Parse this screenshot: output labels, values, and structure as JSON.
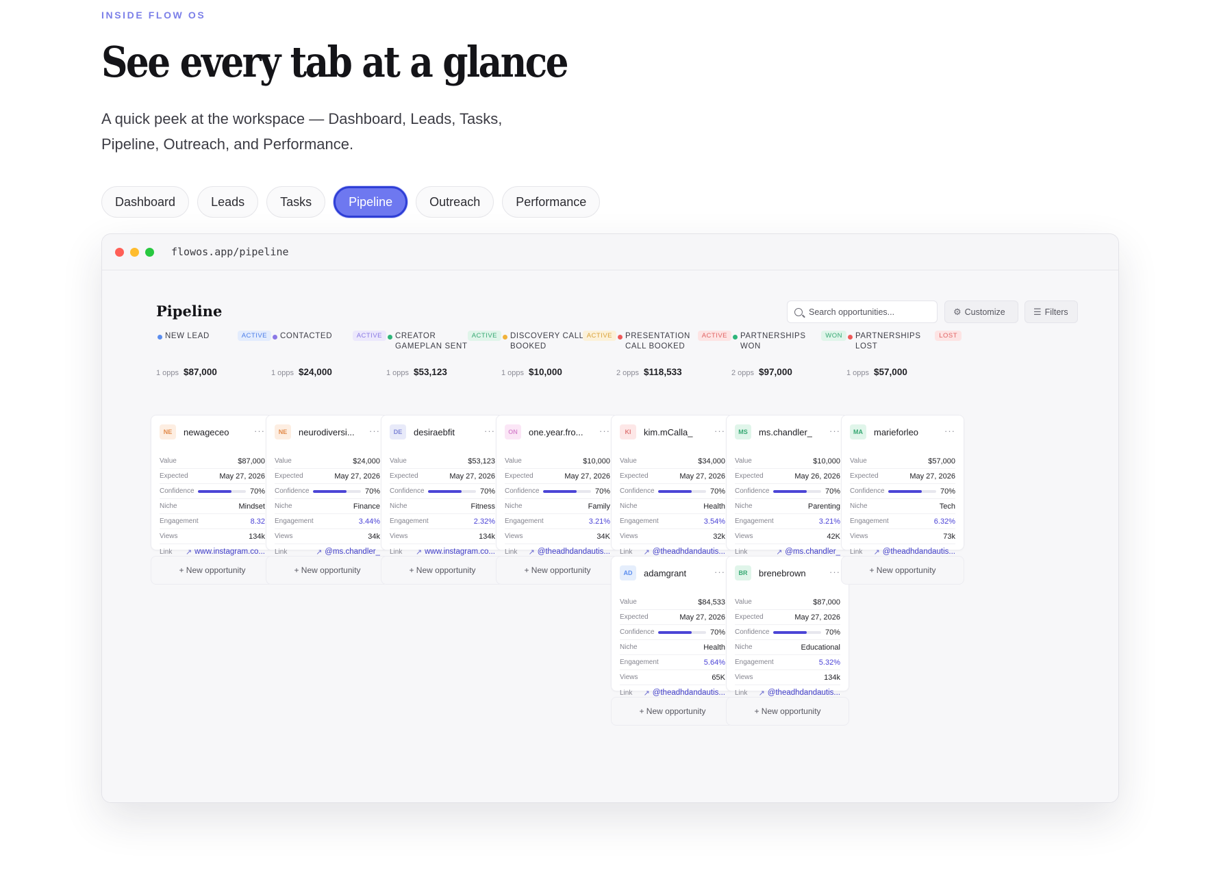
{
  "section": {
    "eyebrow": "INSIDE FLOW OS",
    "headline": "See every tab at a glance",
    "lede": "A quick peek at the workspace — Dashboard, Leads, Tasks, Pipeline, Outreach, and Performance."
  },
  "tabs": [
    {
      "label": "Dashboard",
      "active": false
    },
    {
      "label": "Leads",
      "active": false
    },
    {
      "label": "Tasks",
      "active": false
    },
    {
      "label": "Pipeline",
      "active": true
    },
    {
      "label": "Outreach",
      "active": false
    },
    {
      "label": "Performance",
      "active": false
    }
  ],
  "window": {
    "url": "flowos.app/pipeline",
    "traffic_lights": [
      "#ff5f57",
      "#febc2e",
      "#28c840"
    ]
  },
  "app": {
    "title": "Pipeline",
    "search_placeholder": "Search opportunities...",
    "customize_label": "Customize",
    "filters_label": "Filters",
    "new_opportunity_label": "+ New opportunity"
  },
  "field_labels": {
    "value": "Value",
    "expected": "Expected",
    "confidence": "Confidence",
    "niche": "Niche",
    "engagement": "Engagement",
    "views": "Views",
    "link": "Link"
  },
  "colors": {
    "accent": "#6e78f0",
    "engagement": "#4a42d6",
    "confidence_bar": "#4b45d6"
  },
  "columns": [
    {
      "name": "NEW LEAD",
      "dot_color": "#5b8def",
      "status": "ACTIVE",
      "badge_bg": "#e3ecfd",
      "badge_fg": "#4c7ee8",
      "count": "1 opps",
      "total": "$87,000",
      "cards": [
        {
          "initials": "NE",
          "avatar_bg": "#fdeee2",
          "avatar_fg": "#e28a4a",
          "name": "newageceo",
          "value": "$87,000",
          "expected": "May 27, 2026",
          "confidence": "70%",
          "confidence_pct": 70,
          "niche": "Mindset",
          "engagement": "8.32",
          "views": "134k",
          "link": "www.instagram.co..."
        }
      ]
    },
    {
      "name": "CONTACTED",
      "dot_color": "#8b78e6",
      "status": "ACTIVE",
      "badge_bg": "#ece8fc",
      "badge_fg": "#8a7ae3",
      "count": "1 opps",
      "total": "$24,000",
      "cards": [
        {
          "initials": "NE",
          "avatar_bg": "#fdeee2",
          "avatar_fg": "#e28a4a",
          "name": "neurodiversi...",
          "value": "$24,000",
          "expected": "May 27, 2026",
          "confidence": "70%",
          "confidence_pct": 70,
          "niche": "Finance",
          "engagement": "3.44%",
          "views": "34k",
          "link": "@ms.chandler_"
        }
      ]
    },
    {
      "name": "CREATOR GAMEPLAN SENT",
      "dot_color": "#2fb57a",
      "status": "ACTIVE",
      "badge_bg": "#e0f5ea",
      "badge_fg": "#37a873",
      "count": "1 opps",
      "total": "$53,123",
      "cards": [
        {
          "initials": "DE",
          "avatar_bg": "#e8eaf9",
          "avatar_fg": "#7f86d6",
          "name": "desiraebfit",
          "value": "$53,123",
          "expected": "May 27, 2026",
          "confidence": "70%",
          "confidence_pct": 70,
          "niche": "Fitness",
          "engagement": "2.32%",
          "views": "134k",
          "link": "www.instagram.co..."
        }
      ]
    },
    {
      "name": "DISCOVERY CALL BOOKED",
      "dot_color": "#f0b23a",
      "status": "ACTIVE",
      "badge_bg": "#fcf1d9",
      "badge_fg": "#d9a23a",
      "count": "1 opps",
      "total": "$10,000",
      "cards": [
        {
          "initials": "ON",
          "avatar_bg": "#fbe6f6",
          "avatar_fg": "#d98bd0",
          "name": "one.year.fro...",
          "value": "$10,000",
          "expected": "May 27, 2026",
          "confidence": "70%",
          "confidence_pct": 70,
          "niche": "Family",
          "engagement": "3.21%",
          "views": "34K",
          "link": "@theadhdandautis..."
        }
      ]
    },
    {
      "name": "PRESENTATION CALL BOOKED",
      "dot_color": "#ef5a5a",
      "status": "ACTIVE",
      "badge_bg": "#fde4e4",
      "badge_fg": "#e06363",
      "count": "2 opps",
      "total": "$118,533",
      "cards": [
        {
          "initials": "KI",
          "avatar_bg": "#fde7e7",
          "avatar_fg": "#e07a7a",
          "name": "kim.mCalla_",
          "value": "$34,000",
          "expected": "May 27, 2026",
          "confidence": "70%",
          "confidence_pct": 70,
          "niche": "Health",
          "engagement": "3.54%",
          "views": "32k",
          "link": "@theadhdandautis..."
        },
        {
          "initials": "AD",
          "avatar_bg": "#e5eefc",
          "avatar_fg": "#5b8def",
          "name": "adamgrant",
          "value": "$84,533",
          "expected": "May 27, 2026",
          "confidence": "70%",
          "confidence_pct": 70,
          "niche": "Health",
          "engagement": "5.64%",
          "views": "65K",
          "link": "@theadhdandautis..."
        }
      ]
    },
    {
      "name": "PARTNERSHIPS WON",
      "dot_color": "#2fb57a",
      "status": "WON",
      "badge_bg": "#e0f5ea",
      "badge_fg": "#37a873",
      "count": "2 opps",
      "total": "$97,000",
      "cards": [
        {
          "initials": "MS",
          "avatar_bg": "#e0f5ea",
          "avatar_fg": "#37a873",
          "name": "ms.chandler_",
          "value": "$10,000",
          "expected": "May 26, 2026",
          "confidence": "70%",
          "confidence_pct": 70,
          "niche": "Parenting",
          "engagement": "3.21%",
          "views": "42K",
          "link": "@ms.chandler_"
        },
        {
          "initials": "BR",
          "avatar_bg": "#e0f5ea",
          "avatar_fg": "#37a873",
          "name": "brenebrown",
          "value": "$87,000",
          "expected": "May 27, 2026",
          "confidence": "70%",
          "confidence_pct": 70,
          "niche": "Educational",
          "engagement": "5.32%",
          "views": "134k",
          "link": "@theadhdandautis..."
        }
      ]
    },
    {
      "name": "PARTNERSHIPS LOST",
      "dot_color": "#ef5a5a",
      "status": "LOST",
      "badge_bg": "#fde4e4",
      "badge_fg": "#e06363",
      "count": "1 opps",
      "total": "$57,000",
      "cards": [
        {
          "initials": "MA",
          "avatar_bg": "#e0f5ea",
          "avatar_fg": "#37a873",
          "name": "marieforleo",
          "value": "$57,000",
          "expected": "May 27, 2026",
          "confidence": "70%",
          "confidence_pct": 70,
          "niche": "Tech",
          "engagement": "6.32%",
          "views": "73k",
          "link": "@theadhdandautis..."
        }
      ]
    }
  ]
}
